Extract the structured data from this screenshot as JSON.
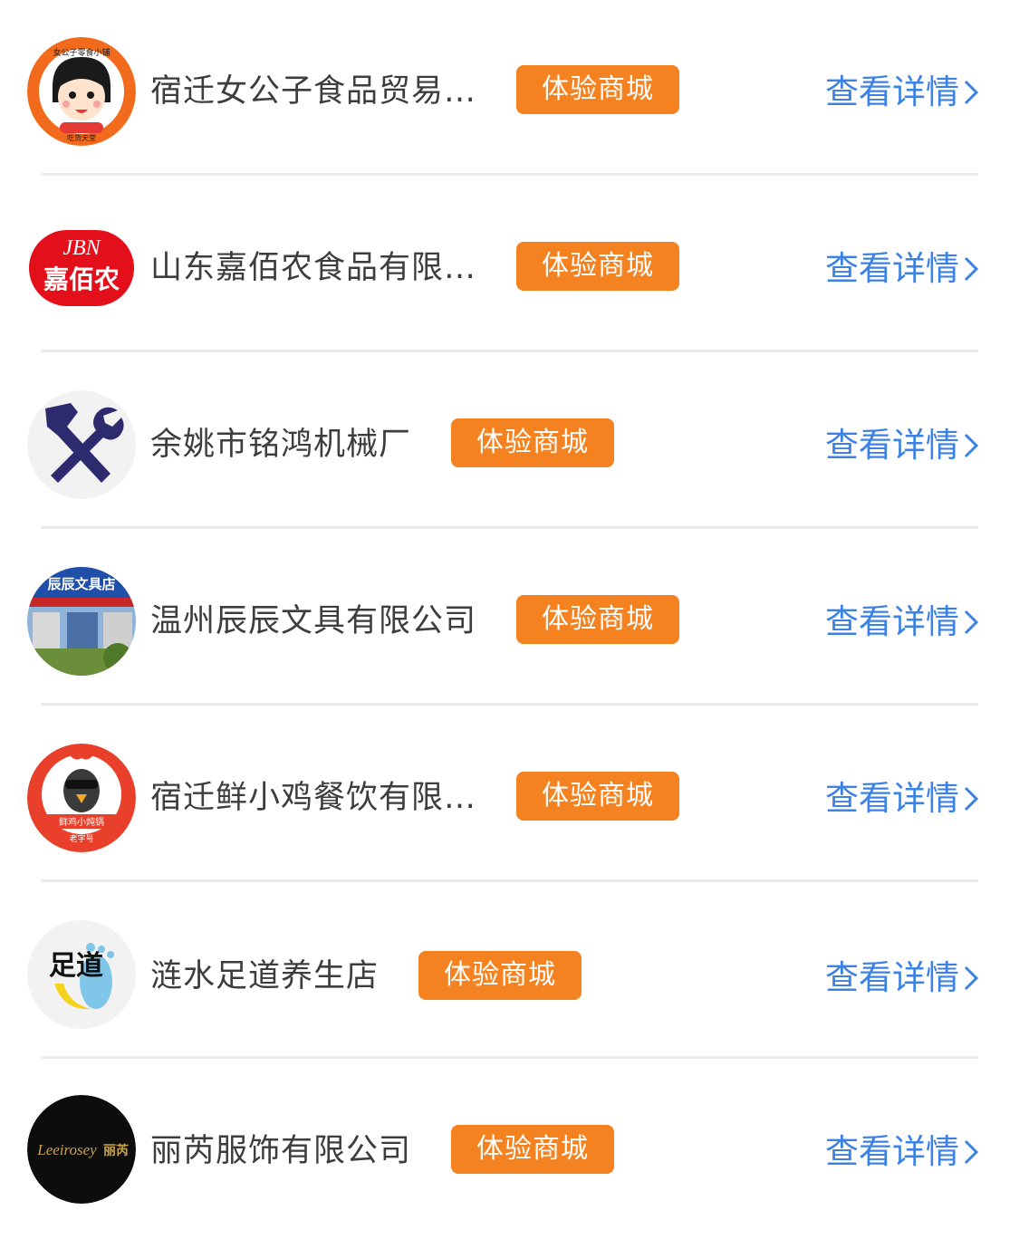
{
  "list": {
    "try_button_label": "体验商城",
    "detail_label": "查看详情",
    "items": [
      {
        "name": "宿迁女公子食品贸易…",
        "logo_text_top": "女公子零食小铺",
        "logo_text_bottom": "吃货天堂"
      },
      {
        "name": "山东嘉佰农食品有限…",
        "logo_text_top": "JBN",
        "logo_text_bottom": "嘉佰农"
      },
      {
        "name": "余姚市铭鸿机械厂"
      },
      {
        "name": "温州辰辰文具有限公司",
        "logo_text_top": "辰辰文具店"
      },
      {
        "name": "宿迁鲜小鸡餐饮有限…",
        "logo_text_top": "鲜鸡小炖锅",
        "logo_text_bottom": "老字号"
      },
      {
        "name": "涟水足道养生店",
        "logo_text_top": "足道"
      },
      {
        "name": "丽芮服饰有限公司",
        "logo_text_top": "Leeirosey",
        "logo_text_bottom": "丽芮"
      }
    ]
  },
  "colors": {
    "button_bg": "#f58220",
    "detail_link": "#3b82e4",
    "name_text": "#3d3d3d",
    "separator": "#ececec"
  }
}
